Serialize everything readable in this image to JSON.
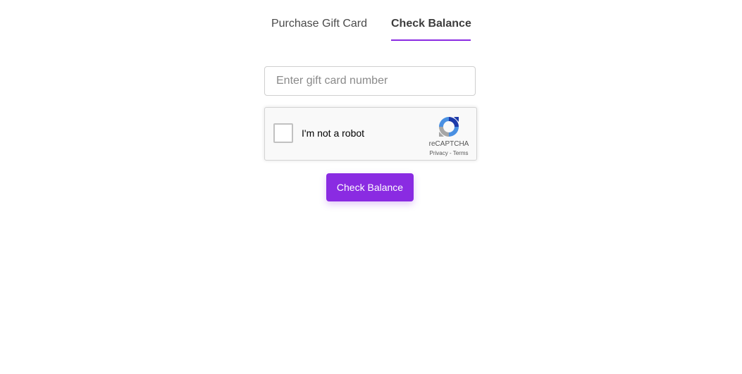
{
  "tabs": {
    "purchase_label": "Purchase Gift Card",
    "balance_label": "Check Balance",
    "active": "balance"
  },
  "form": {
    "card_placeholder": "Enter gift card number",
    "card_value": "",
    "submit_label": "Check Balance"
  },
  "recaptcha": {
    "label": "I'm not a robot",
    "brand": "reCAPTCHA",
    "privacy": "Privacy",
    "separator": " - ",
    "terms": "Terms",
    "icon": "recaptcha-logo",
    "checked": false
  },
  "colors": {
    "accent": "#8a2be2",
    "text": "#4a4a4a",
    "border": "#cfcfcf"
  }
}
